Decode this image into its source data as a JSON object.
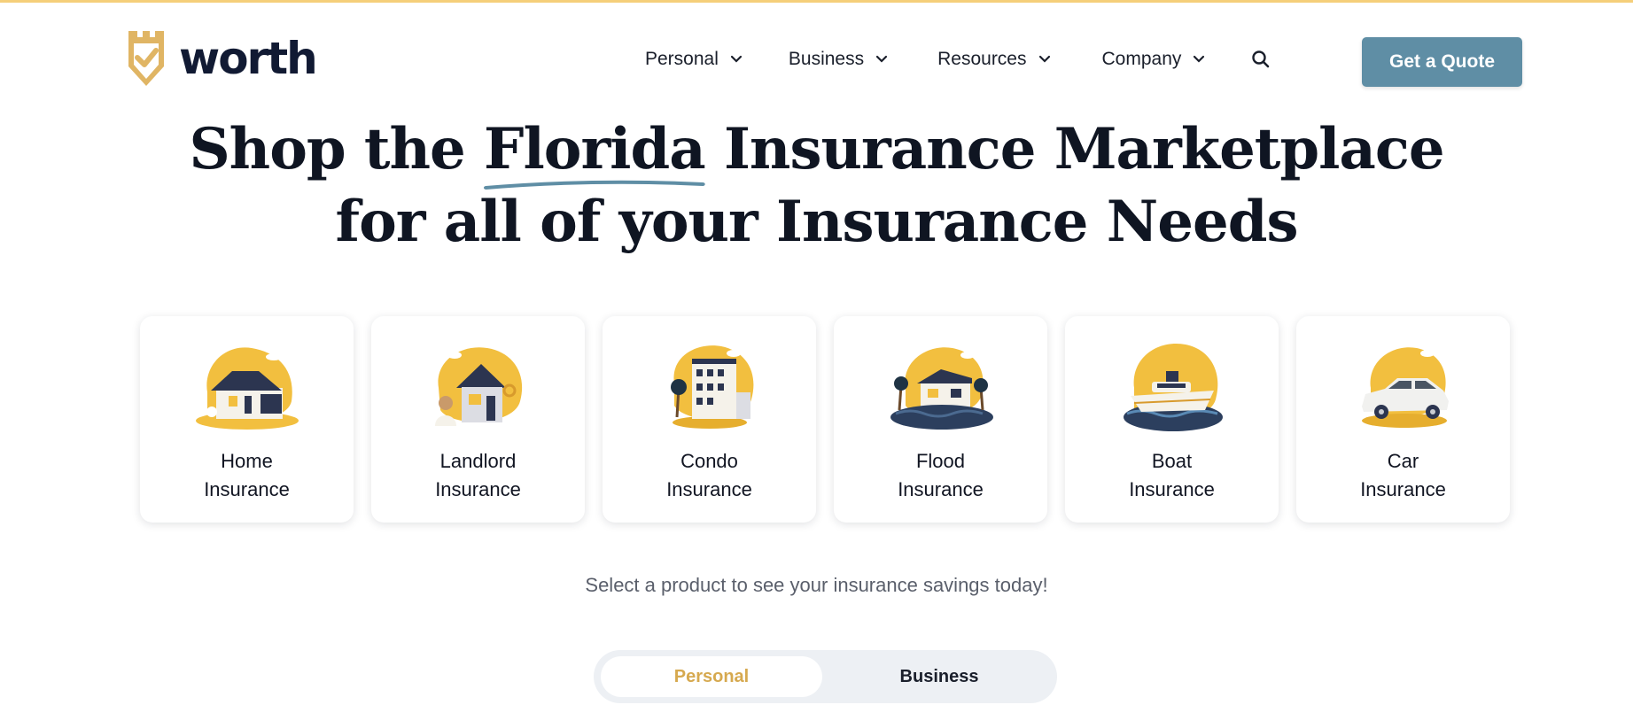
{
  "header": {
    "logo_text": "worth",
    "nav": [
      {
        "label": "Personal",
        "icon": "chevron-down-icon"
      },
      {
        "label": "Business",
        "icon": "chevron-down-icon"
      },
      {
        "label": "Resources",
        "icon": "chevron-down-icon"
      },
      {
        "label": "Company",
        "icon": "chevron-down-icon"
      }
    ],
    "search_icon": "search-icon",
    "cta_label": "Get a Quote"
  },
  "hero": {
    "line1_pre": "Shop the ",
    "line1_highlight": "Florida",
    "line1_post": " Insurance Marketplace",
    "line2": "for all of your Insurance Needs"
  },
  "products": [
    {
      "line1": "Home",
      "line2": "Insurance",
      "icon": "house-icon"
    },
    {
      "line1": "Landlord",
      "line2": "Insurance",
      "icon": "landlord-icon"
    },
    {
      "line1": "Condo",
      "line2": "Insurance",
      "icon": "condo-building-icon"
    },
    {
      "line1": "Flood",
      "line2": "Insurance",
      "icon": "flooded-house-icon"
    },
    {
      "line1": "Boat",
      "line2": "Insurance",
      "icon": "boat-icon"
    },
    {
      "line1": "Car",
      "line2": "Insurance",
      "icon": "car-icon"
    }
  ],
  "subtitle": "Select a product to see your insurance savings today!",
  "toggle": {
    "options": [
      "Personal",
      "Business"
    ],
    "selected": "Personal"
  },
  "colors": {
    "accent_gold": "#f2bf3f",
    "brand_navy": "#111a33",
    "cta_blue": "#5f8ea5",
    "underline_blue": "#5f8ea5",
    "top_strip": "#f5cf7a"
  }
}
